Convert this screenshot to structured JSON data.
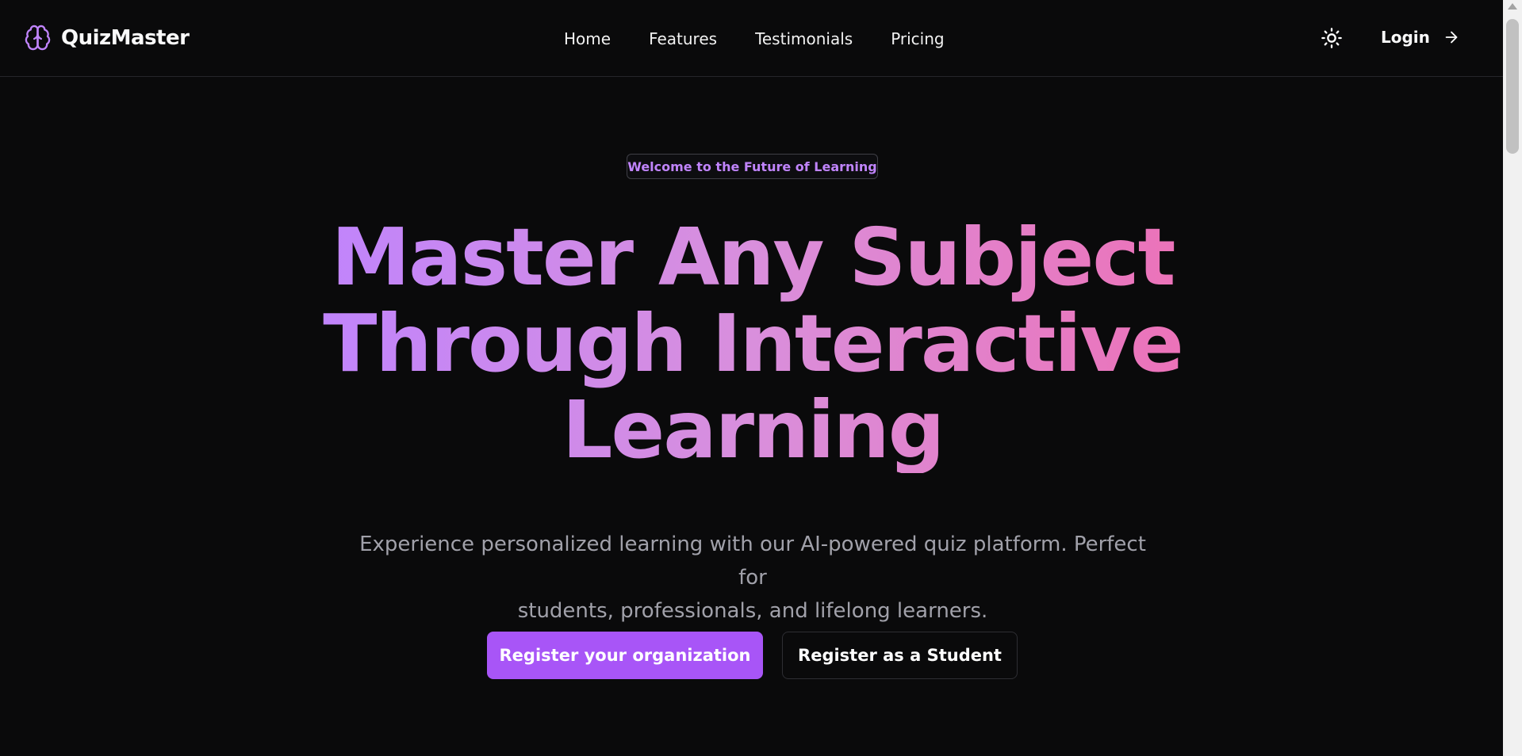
{
  "brand": {
    "name": "QuizMaster",
    "icon": "brain-icon",
    "accent": "#c084fc"
  },
  "nav": {
    "items": [
      {
        "label": "Home"
      },
      {
        "label": "Features"
      },
      {
        "label": "Testimonials"
      },
      {
        "label": "Pricing"
      }
    ]
  },
  "header_actions": {
    "theme_icon": "sun-icon",
    "login_label": "Login",
    "login_icon": "arrow-right-icon"
  },
  "hero": {
    "badge": "Welcome to the Future of Learning",
    "headline_line1": "Master Any Subject",
    "headline_line2": "Through Interactive",
    "headline_line3": "Learning",
    "subtitle_line1": "Experience personalized learning with our AI-powered quiz platform. Perfect for",
    "subtitle_line2": "students, professionals, and lifelong learners.",
    "gradient_colors": [
      "#c084fc",
      "#ec72b8"
    ]
  },
  "cta": {
    "primary_label": "Register your organization",
    "secondary_label": "Register as a Student",
    "primary_color": "#a855f7"
  }
}
